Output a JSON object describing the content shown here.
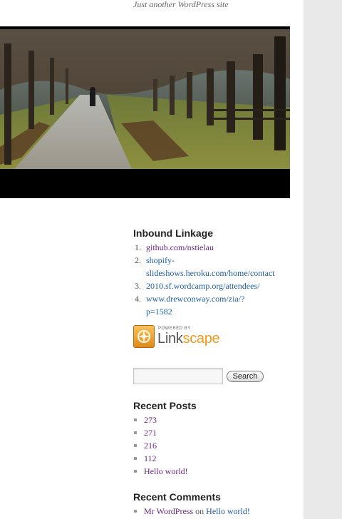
{
  "site": {
    "tagline": "Just another WordPress site"
  },
  "header": {
    "image_description_icon": "park-path-photo"
  },
  "inbound_linkage": {
    "title": "Inbound Linkage",
    "items": [
      {
        "num": "1.",
        "lines": [
          "github.com/nstielau"
        ],
        "visited": true
      },
      {
        "num": "2.",
        "lines": [
          "shopify-",
          "slideshows.heroku.com/home/contact"
        ],
        "visited": false
      },
      {
        "num": "3.",
        "lines": [
          "2010.sf.wordcamp.org/attendees/"
        ],
        "visited": false
      },
      {
        "num": "4.",
        "lines": [
          "www.drewconway.com/zia/?",
          "p=1582"
        ],
        "visited": false
      }
    ]
  },
  "linkscape": {
    "powered_by": "POWERED BY",
    "word_a": "Link",
    "word_b": "scape",
    "icon": "compass-icon"
  },
  "search": {
    "placeholder": "",
    "button_label": "Search"
  },
  "recent_posts": {
    "title": "Recent Posts",
    "items": [
      "273",
      "271",
      "216",
      "112",
      "Hello world!"
    ]
  },
  "recent_comments": {
    "title": "Recent Comments",
    "items": [
      {
        "author": "Mr WordPress",
        "on": "on",
        "post": "Hello world!"
      }
    ]
  },
  "colors": {
    "link": "#1b5fa6",
    "visited": "#6b2585",
    "gutter": "#e9e9e9",
    "accent": "#f39a1c"
  }
}
